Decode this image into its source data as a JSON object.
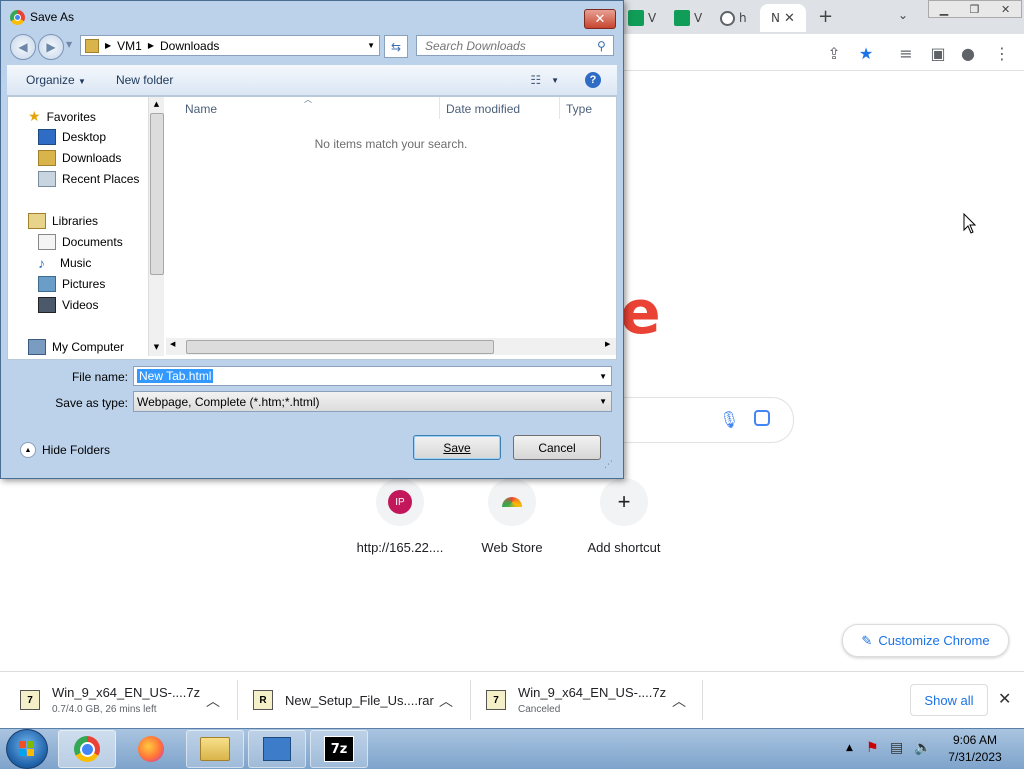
{
  "chrome": {
    "tabs": [
      {
        "label": "V",
        "color": "#0f9d58"
      },
      {
        "label": "V",
        "color": "#0f9d58"
      },
      {
        "label": "h",
        "color": "#5f6368"
      },
      {
        "label": "N",
        "color": "#5f6368"
      }
    ],
    "new_tab_label": "+",
    "shortcuts": [
      {
        "label": "http://165.22....",
        "badge": "IP"
      },
      {
        "label": "Web Store"
      },
      {
        "label": "Add shortcut",
        "glyph": "+"
      }
    ],
    "customize_label": "Customize Chrome",
    "logo_fragment": "e"
  },
  "downloads": {
    "items": [
      {
        "name": "Win_9_x64_EN_US-....7z",
        "status": "0.7/4.0 GB, 26 mins left",
        "icon": "7z-file-icon"
      },
      {
        "name": "New_Setup_File_Us....rar",
        "status": "",
        "icon": "rar-file-icon"
      },
      {
        "name": "Win_9_x64_EN_US-....7z",
        "status": "Canceled",
        "icon": "7z-file-icon"
      }
    ],
    "show_all": "Show all"
  },
  "dialog": {
    "title": "Save As",
    "breadcrumb": [
      "VM1",
      "Downloads"
    ],
    "search_placeholder": "Search Downloads",
    "organize": "Organize",
    "new_folder": "New folder",
    "nav": {
      "favorites": "Favorites",
      "desktop": "Desktop",
      "downloads": "Downloads",
      "recent": "Recent Places",
      "libraries": "Libraries",
      "documents": "Documents",
      "music": "Music",
      "pictures": "Pictures",
      "videos": "Videos",
      "computer": "My Computer"
    },
    "columns": {
      "name": "Name",
      "date": "Date modified",
      "type": "Type"
    },
    "empty_message": "No items match your search.",
    "file_name_label": "File name:",
    "file_name_value": "New Tab.html",
    "save_type_label": "Save as type:",
    "save_type_value": "Webpage, Complete (*.htm;*.html)",
    "hide_folders": "Hide Folders",
    "save": "Save",
    "cancel": "Cancel"
  },
  "taskbar": {
    "time": "9:06 AM",
    "date": "7/31/2023",
    "seven_zip_label": "7z"
  }
}
